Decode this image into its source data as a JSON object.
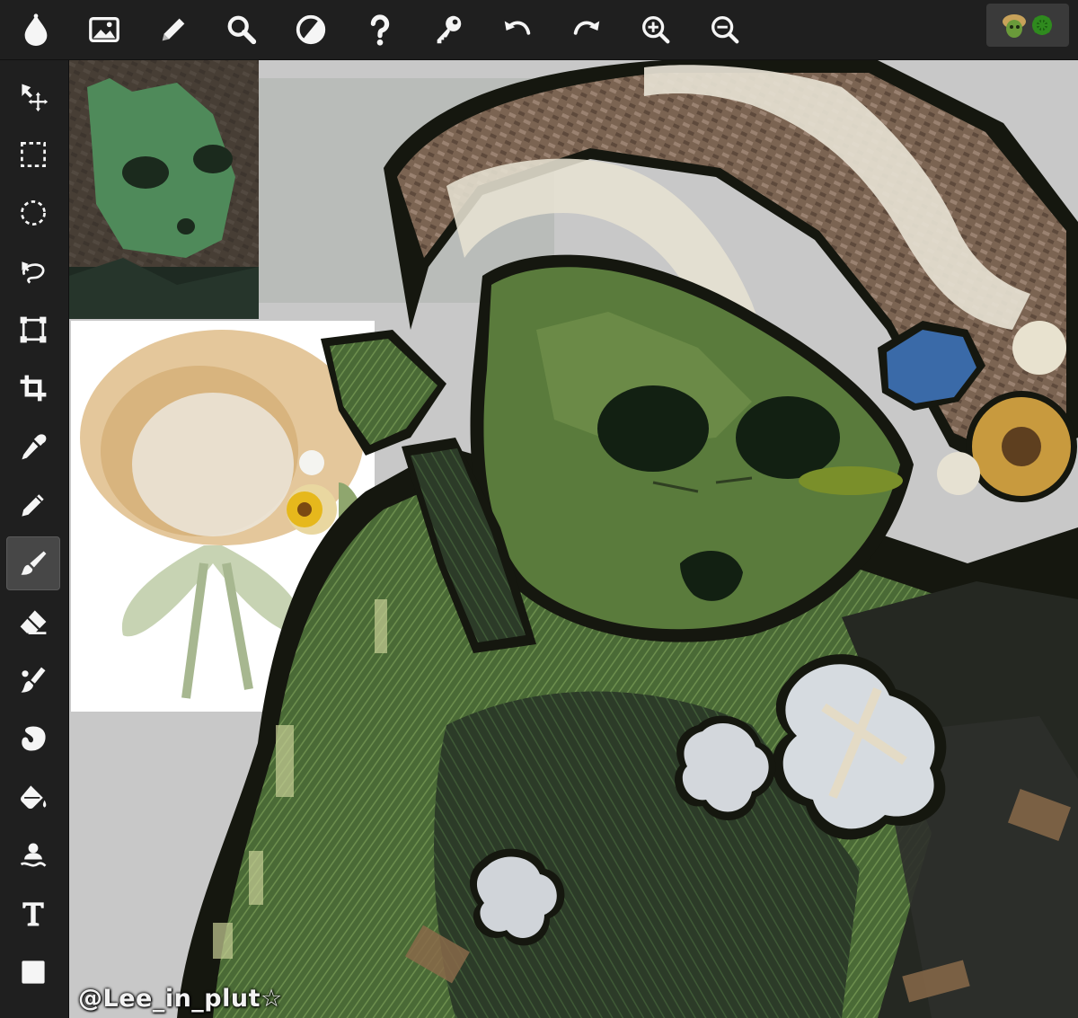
{
  "app": {
    "accent": "#474747",
    "toolbar_bg": "#1f1f1f",
    "icon_color": "#f5f5f5"
  },
  "top_toolbar": {
    "items": [
      {
        "name": "app-logo-icon",
        "icon": "droplet"
      },
      {
        "name": "image-icon",
        "icon": "image"
      },
      {
        "name": "pencil-icon",
        "icon": "pencil"
      },
      {
        "name": "search-icon",
        "icon": "magnifier"
      },
      {
        "name": "contrast-icon",
        "icon": "half-circle"
      },
      {
        "name": "help-icon",
        "icon": "question-mark"
      },
      {
        "name": "key-icon",
        "icon": "key"
      },
      {
        "name": "undo-icon",
        "icon": "undo-arrow"
      },
      {
        "name": "redo-icon",
        "icon": "redo-arrow"
      },
      {
        "name": "zoom-in-icon",
        "icon": "magnifier-plus"
      },
      {
        "name": "zoom-out-icon",
        "icon": "magnifier-minus"
      }
    ],
    "layer_thumbnail": "green-character-thumbnail"
  },
  "left_toolbar": {
    "active_tool": "brush",
    "tools": [
      {
        "name": "move-tool",
        "icon": "move-arrows"
      },
      {
        "name": "rect-select-tool",
        "icon": "dashed-rectangle"
      },
      {
        "name": "ellipse-select-tool",
        "icon": "dashed-circle"
      },
      {
        "name": "lasso-tool",
        "icon": "lasso"
      },
      {
        "name": "transform-tool",
        "icon": "transform-box"
      },
      {
        "name": "crop-tool",
        "icon": "crop"
      },
      {
        "name": "eyedropper-tool",
        "icon": "eyedropper"
      },
      {
        "name": "pencil-tool",
        "icon": "pencil"
      },
      {
        "name": "brush-tool",
        "icon": "brush"
      },
      {
        "name": "eraser-tool",
        "icon": "eraser"
      },
      {
        "name": "smudge-tool",
        "icon": "smudge-brush"
      },
      {
        "name": "blur-tool",
        "icon": "blob"
      },
      {
        "name": "fill-tool",
        "icon": "paint-bucket"
      },
      {
        "name": "clone-tool",
        "icon": "stamp"
      },
      {
        "name": "text-tool",
        "icon": "letter-T"
      },
      {
        "name": "color-swatch",
        "icon": "white-square"
      }
    ]
  },
  "canvas": {
    "background": "#c9c9c9",
    "watermark": "@Lee_in_plut☆"
  }
}
